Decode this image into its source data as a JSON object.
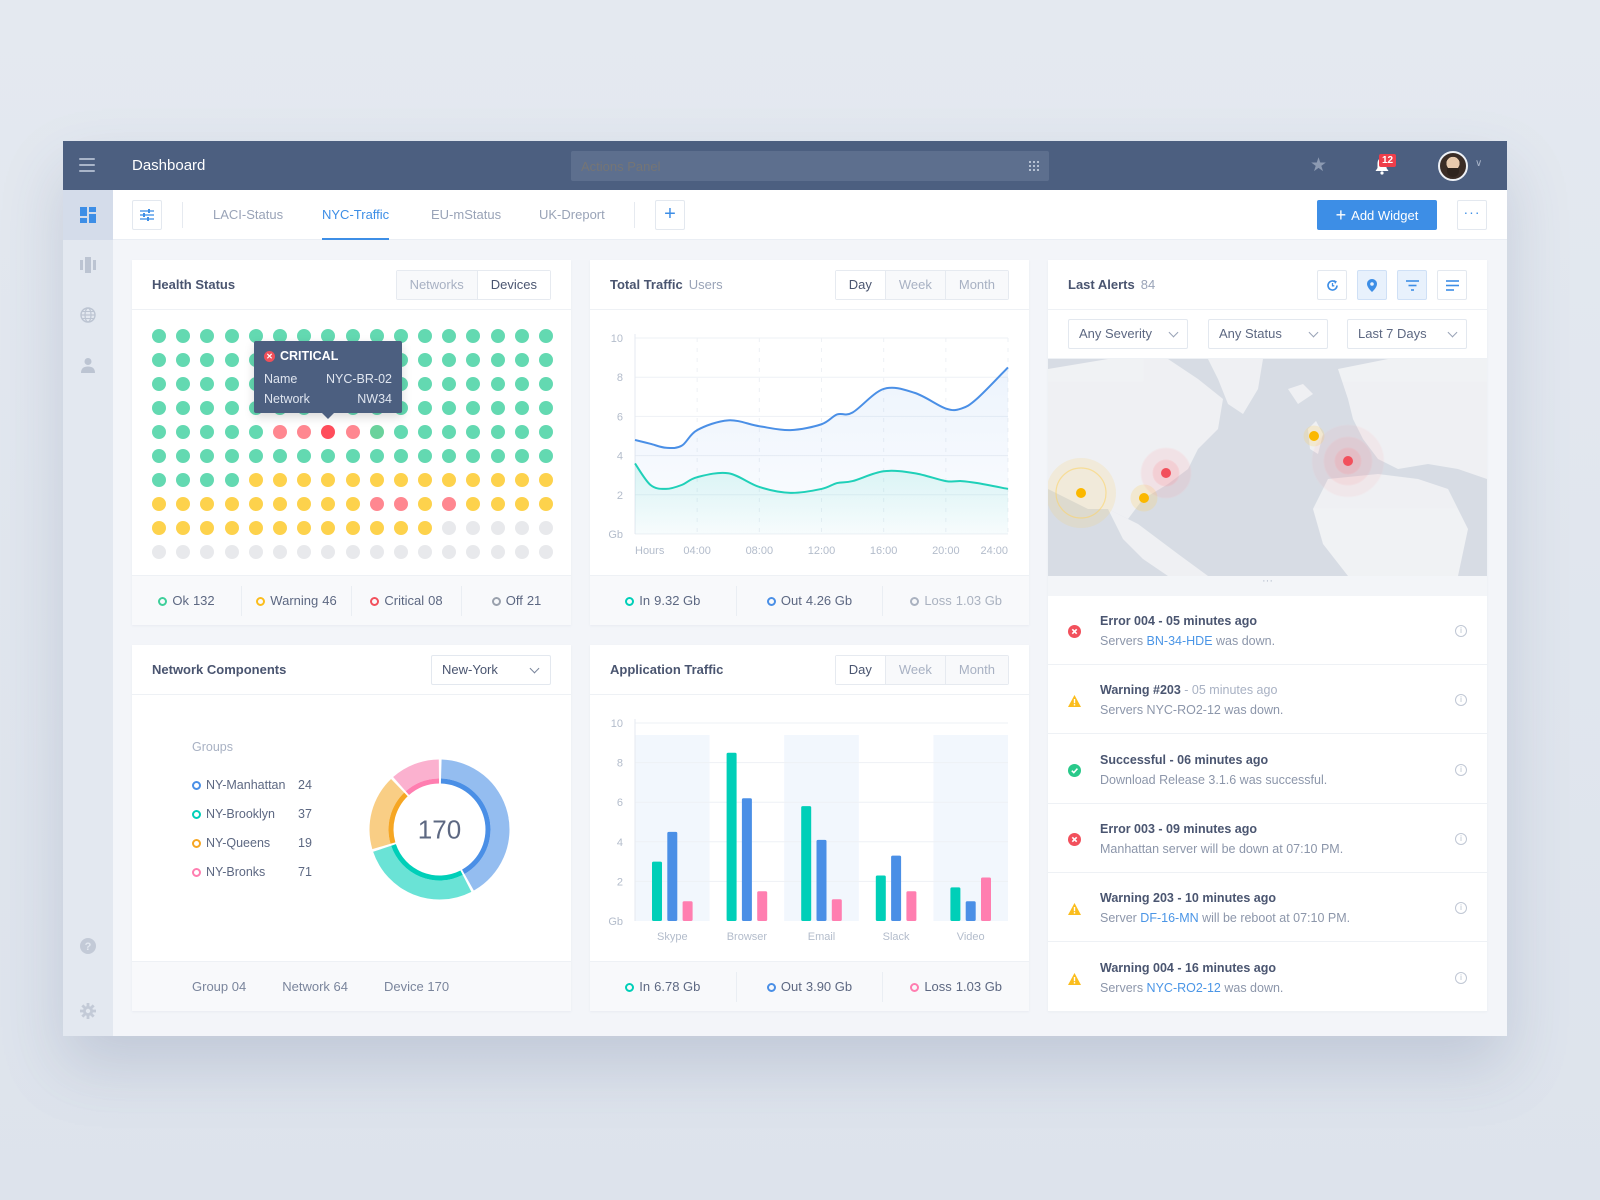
{
  "topbar": {
    "title": "Dashboard",
    "actions_placeholder": "Actions Panel",
    "notification_count": "12"
  },
  "tabs": {
    "items": [
      {
        "label": "LACI-Status",
        "active": false
      },
      {
        "label": "NYC-Traffic",
        "active": true
      },
      {
        "label": "EU-mStatus",
        "active": false
      },
      {
        "label": "UK-Dreport",
        "active": false
      }
    ],
    "add_widget_label": "Add Widget",
    "more_label": "···"
  },
  "sidebar": {
    "items": [
      "dashboard-icon",
      "columns-icon",
      "globe-icon",
      "user-icon"
    ],
    "bottom": [
      "help-icon",
      "gear-icon"
    ]
  },
  "health": {
    "title": "Health Status",
    "toggle": [
      "Networks",
      "Devices"
    ],
    "toggle_active": 1,
    "colors": {
      "ok": "#63d9b1",
      "warning": "#fdd24c",
      "critical": "#ff8790",
      "critical_active": "#ff4d5b",
      "off": "#e8e9ec",
      "ok_alt": "#6ad29c"
    },
    "grid": [
      "ooooooooooooooooo",
      "ooooooooooooooooo",
      "ooooooooooooooooo",
      "ooooooooooooooooo",
      "oooooccCcaooooooo",
      "ooooooooooooooooo",
      "oooowwwwwwwwwwwww",
      "wwwwwwwwwccwcwwww",
      "wwwwwwwwwwwwfffff",
      "fffffffffffffffff"
    ],
    "tooltip": {
      "status": "CRITICAL",
      "name_label": "Name",
      "name_value": "NYC-BR-02",
      "network_label": "Network",
      "network_value": "NW34"
    },
    "footer": [
      {
        "label": "Ok",
        "value": "132",
        "color": "#3ecf9a"
      },
      {
        "label": "Warning",
        "value": "46",
        "color": "#fbbd1d"
      },
      {
        "label": "Critical",
        "value": "08",
        "color": "#f2505c"
      },
      {
        "label": "Off",
        "value": "21",
        "color": "#9aa1ad"
      }
    ]
  },
  "traffic": {
    "title": "Total Traffic",
    "subtitle": "Users",
    "periods": [
      "Day",
      "Week",
      "Month"
    ],
    "period_active": 0,
    "footer": [
      {
        "label": "In",
        "value": "9.32 Gb",
        "color": "#00cfb8",
        "muted": false
      },
      {
        "label": "Out",
        "value": "4.26 Gb",
        "color": "#4a8fe6",
        "muted": false
      },
      {
        "label": "Loss",
        "value": "1.03 Gb",
        "color": "#aab2c0",
        "muted": true
      }
    ]
  },
  "network": {
    "title": "Network Components",
    "location": "New-York",
    "groups_title": "Groups",
    "total": "170",
    "footer": [
      {
        "label": "Group",
        "value": "04"
      },
      {
        "label": "Network",
        "value": "64"
      },
      {
        "label": "Device",
        "value": "170"
      }
    ]
  },
  "apptraffic": {
    "title": "Application Traffic",
    "periods": [
      "Day",
      "Week",
      "Month"
    ],
    "period_active": 0,
    "footer": [
      {
        "label": "In",
        "value": "6.78 Gb",
        "color": "#00cfb8"
      },
      {
        "label": "Out",
        "value": "3.90 Gb",
        "color": "#4a8fe6"
      },
      {
        "label": "Loss",
        "value": "1.03 Gb",
        "color": "#ff7eb0"
      }
    ]
  },
  "alerts": {
    "title": "Last Alerts",
    "count": "84",
    "filters": [
      "Any Severity",
      "Any Status",
      "Last 7 Days"
    ],
    "map_markers": [
      {
        "name": "los-angeles",
        "level": "warning"
      },
      {
        "name": "atlanta",
        "level": "warning"
      },
      {
        "name": "new-york",
        "level": "critical"
      },
      {
        "name": "london",
        "level": "warning"
      },
      {
        "name": "central-europe",
        "level": "critical"
      }
    ],
    "items": [
      {
        "type": "error",
        "title": "Error 004 - 05 minutes ago",
        "title_muted": "",
        "pre": "Servers ",
        "link": "BN-34-HDE",
        "post": " was down."
      },
      {
        "type": "warning",
        "title": "Warning #203",
        "title_muted": " - 05 minutes ago",
        "pre": "Servers NYC-RO2-12 was down.",
        "link": "",
        "post": ""
      },
      {
        "type": "success",
        "title": "Successful - 06 minutes ago",
        "title_muted": "",
        "pre": "Download Release 3.1.6 was successful.",
        "link": "",
        "post": ""
      },
      {
        "type": "error",
        "title": "Error 003 - 09 minutes ago",
        "title_muted": "",
        "pre": "Manhattan server will be down at 07:10 PM.",
        "link": "",
        "post": ""
      },
      {
        "type": "warning",
        "title": "Warning 203 - 10 minutes ago",
        "title_muted": "",
        "pre": "Server ",
        "link": "DF-16-MN",
        "post": " will be reboot at 07:10 PM."
      },
      {
        "type": "warning",
        "title": "Warning 004 - 16 minutes ago",
        "title_muted": "",
        "pre": "Servers ",
        "link": "NYC-RO2-12",
        "post": " was down."
      }
    ]
  },
  "chart_data": [
    {
      "type": "line",
      "title": "Total Traffic",
      "xlabel": "Hours",
      "ylabel": "Gb",
      "x_ticks": [
        "04:00",
        "08:00",
        "12:00",
        "16:00",
        "20:00",
        "24:00"
      ],
      "y_ticks": [
        "2",
        "4",
        "6",
        "8",
        "10"
      ],
      "xlim": [
        0,
        24
      ],
      "ylim": [
        0,
        10
      ],
      "grid": true,
      "x": [
        0,
        1,
        2,
        3,
        4,
        6,
        8,
        10,
        12,
        13,
        14,
        16,
        18,
        20,
        21,
        22,
        24
      ],
      "series": [
        {
          "name": "Out",
          "color": "#4a8fe6",
          "values": [
            4.8,
            4.6,
            4.4,
            4.5,
            5.3,
            5.8,
            5.5,
            5.3,
            5.6,
            6.1,
            6.2,
            7.4,
            7.2,
            6.4,
            6.4,
            6.9,
            8.5
          ]
        },
        {
          "name": "In",
          "color": "#1fd0b8",
          "values": [
            3.6,
            2.5,
            2.3,
            2.5,
            2.9,
            3.1,
            2.4,
            2.1,
            2.3,
            2.6,
            2.7,
            3.2,
            3.1,
            2.7,
            2.7,
            2.6,
            2.3
          ]
        }
      ]
    },
    {
      "type": "bar",
      "title": "Application Traffic",
      "ylabel": "Gb",
      "categories": [
        "Skype",
        "Browser",
        "Email",
        "Slack",
        "Video"
      ],
      "y_ticks": [
        "2",
        "4",
        "6",
        "8",
        "10"
      ],
      "ylim": [
        0,
        10
      ],
      "grid": true,
      "series": [
        {
          "name": "In",
          "color": "#00cfb8",
          "values": [
            3.0,
            8.5,
            5.8,
            2.3,
            1.7
          ]
        },
        {
          "name": "Out",
          "color": "#4a8fe6",
          "values": [
            4.5,
            6.2,
            4.1,
            3.3,
            1.0
          ]
        },
        {
          "name": "Loss",
          "color": "#ff7eb0",
          "values": [
            1.0,
            1.5,
            1.1,
            1.5,
            2.2
          ]
        }
      ]
    },
    {
      "type": "pie",
      "title": "Network Components",
      "center_label": "170",
      "categories": [
        "NY-Manhattan",
        "NY-Brooklyn",
        "NY-Queens",
        "NY-Bronks"
      ],
      "values": [
        24,
        37,
        19,
        71
      ],
      "legend_values": [
        "24",
        "37",
        "19",
        "71"
      ],
      "colors": [
        {
          "outer": "#94bdf0",
          "inner": "#4a8fe6",
          "marker": "#4a8fe6"
        },
        {
          "outer": "#6ae3d6",
          "inner": "#00cfb8",
          "marker": "#00cfb8"
        },
        {
          "outer": "#f9ce85",
          "inner": "#f6a623",
          "marker": "#f6a623"
        },
        {
          "outer": "#fbb1cf",
          "inner": "#ff7eb0",
          "marker": "#ff7eb0"
        }
      ],
      "visual_share": [
        0.42,
        0.28,
        0.18,
        0.12
      ]
    }
  ]
}
